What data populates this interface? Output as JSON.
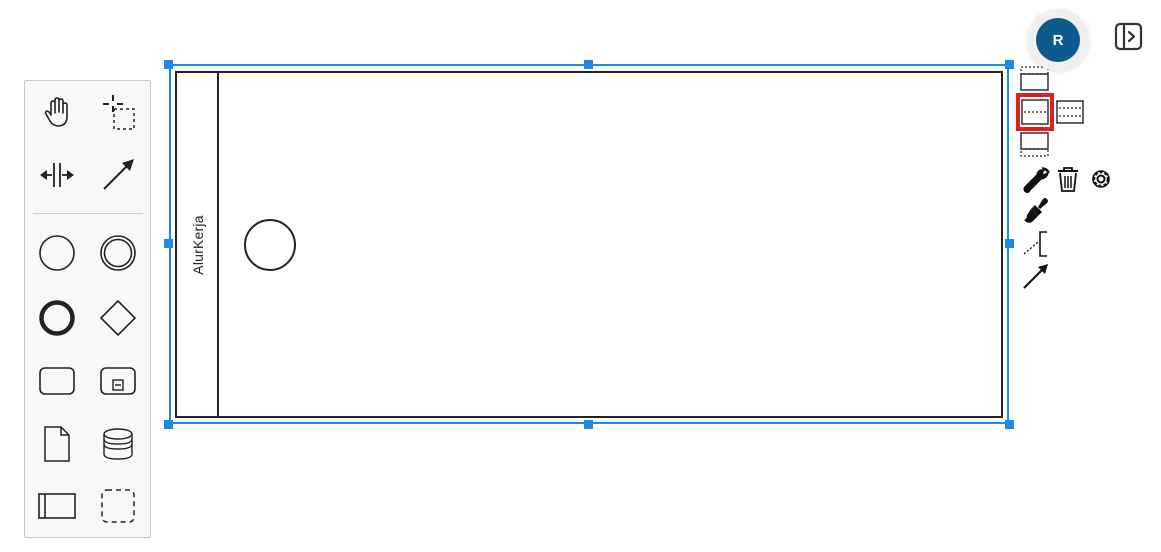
{
  "user": {
    "avatar_initial": "R"
  },
  "pool": {
    "label": "AlurKerja"
  },
  "colors": {
    "selection": "#1e8ae6",
    "highlight": "#e02020",
    "avatar": "#0d5a8c",
    "stroke": "#222222"
  },
  "palette": {
    "tools": [
      {
        "name": "hand-tool",
        "icon": "hand-icon"
      },
      {
        "name": "lasso-tool",
        "icon": "lasso-icon"
      },
      {
        "name": "space-tool",
        "icon": "space-icon"
      },
      {
        "name": "global-connect-tool",
        "icon": "connect-arrow-icon"
      },
      {
        "name": "create-start-event",
        "icon": "start-event-icon"
      },
      {
        "name": "create-intermediate-event",
        "icon": "intermediate-event-icon"
      },
      {
        "name": "create-end-event",
        "icon": "end-event-icon"
      },
      {
        "name": "create-gateway",
        "icon": "gateway-icon"
      },
      {
        "name": "create-task",
        "icon": "task-icon"
      },
      {
        "name": "create-subprocess",
        "icon": "subprocess-icon"
      },
      {
        "name": "create-data-object",
        "icon": "data-object-icon"
      },
      {
        "name": "create-data-store",
        "icon": "data-store-icon"
      },
      {
        "name": "create-pool",
        "icon": "pool-icon"
      },
      {
        "name": "create-group",
        "icon": "group-icon"
      }
    ]
  },
  "context_pad": {
    "items": [
      {
        "name": "lane-insert-above",
        "icon": "lane-insert-above-icon"
      },
      {
        "name": "lane-divide-two",
        "icon": "lane-divide-two-icon"
      },
      {
        "name": "lane-divide-three",
        "icon": "lane-divide-three-icon"
      },
      {
        "name": "lane-insert-below",
        "icon": "lane-insert-below-icon"
      },
      {
        "name": "replace",
        "icon": "wrench-icon"
      },
      {
        "name": "delete",
        "icon": "trash-icon"
      },
      {
        "name": "settings",
        "icon": "gear-icon"
      },
      {
        "name": "color",
        "icon": "paintbrush-icon"
      },
      {
        "name": "text-annotation",
        "icon": "text-annotation-icon"
      },
      {
        "name": "connect",
        "icon": "connect-arrow-icon"
      }
    ]
  }
}
